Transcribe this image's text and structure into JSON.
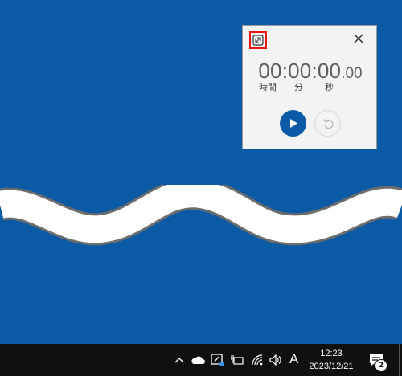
{
  "stopwatch": {
    "time_main": "00:00:00",
    "time_fraction": ".00",
    "label_hours": "時間",
    "label_minutes": "分",
    "label_seconds": "秒",
    "icons": [
      "expand-icon",
      "close-icon",
      "play-icon",
      "reset-icon"
    ],
    "accent_color": "#0b5aa6",
    "highlight_color": "#e11111"
  },
  "taskbar": {
    "ime_label": "A",
    "time": "12:23",
    "date": "2023/12/21",
    "notification_count": "2",
    "tray_icons": [
      "chevron-up-icon",
      "onedrive-cloud-icon",
      "pen-workspace-icon",
      "battery-plug-icon",
      "wifi-icon",
      "volume-icon"
    ]
  },
  "desktop": {
    "background_color": "#0b5aa6"
  }
}
